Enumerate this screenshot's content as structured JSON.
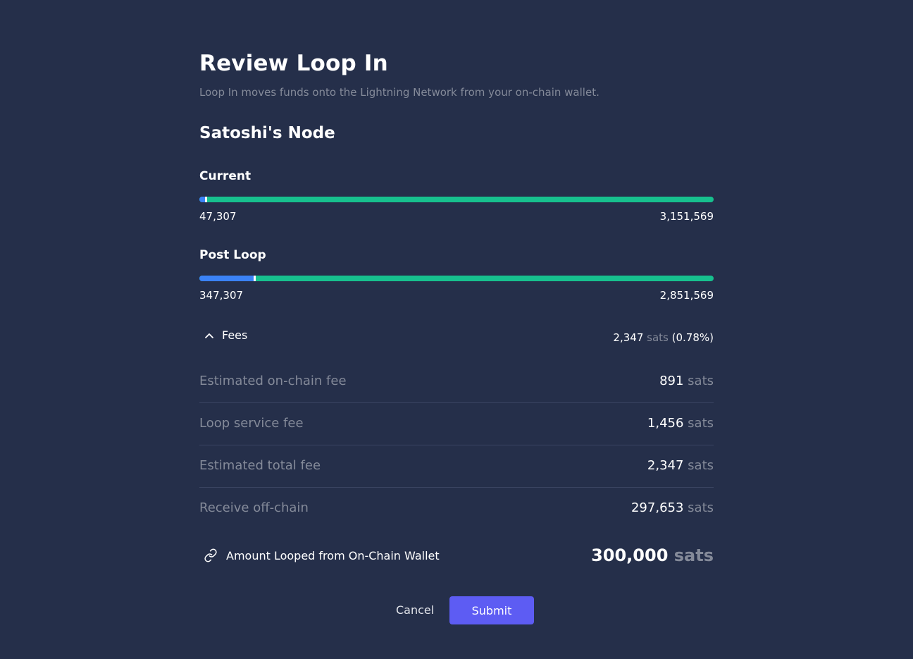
{
  "header": {
    "title": "Review Loop In",
    "subtitle": "Loop In moves funds onto the Lightning Network from your on-chain wallet."
  },
  "node": {
    "name": "Satoshi's Node"
  },
  "current": {
    "label": "Current",
    "local": "47,307",
    "remote": "3,151,569",
    "local_fraction": 0.015
  },
  "post_loop": {
    "label": "Post Loop",
    "local": "347,307",
    "remote": "2,851,569",
    "local_fraction": 0.11
  },
  "fees": {
    "toggle_label": "Fees",
    "total_amount": "2,347",
    "total_unit": "sats",
    "total_percent": "(0.78%)",
    "rows": [
      {
        "label": "Estimated on-chain fee",
        "amount": "891",
        "unit": "sats"
      },
      {
        "label": "Loop service fee",
        "amount": "1,456",
        "unit": "sats"
      },
      {
        "label": "Estimated total fee",
        "amount": "2,347",
        "unit": "sats"
      },
      {
        "label": "Receive off-chain",
        "amount": "297,653",
        "unit": "sats"
      }
    ]
  },
  "amount": {
    "label": "Amount Looped from On-Chain Wallet",
    "value": "300,000",
    "unit": "sats"
  },
  "actions": {
    "cancel_label": "Cancel",
    "submit_label": "Submit"
  },
  "colors": {
    "background": "#252f4a",
    "local_balance": "#3b82f6",
    "remote_balance": "#17c08e",
    "primary_button": "#5d5cf3"
  }
}
